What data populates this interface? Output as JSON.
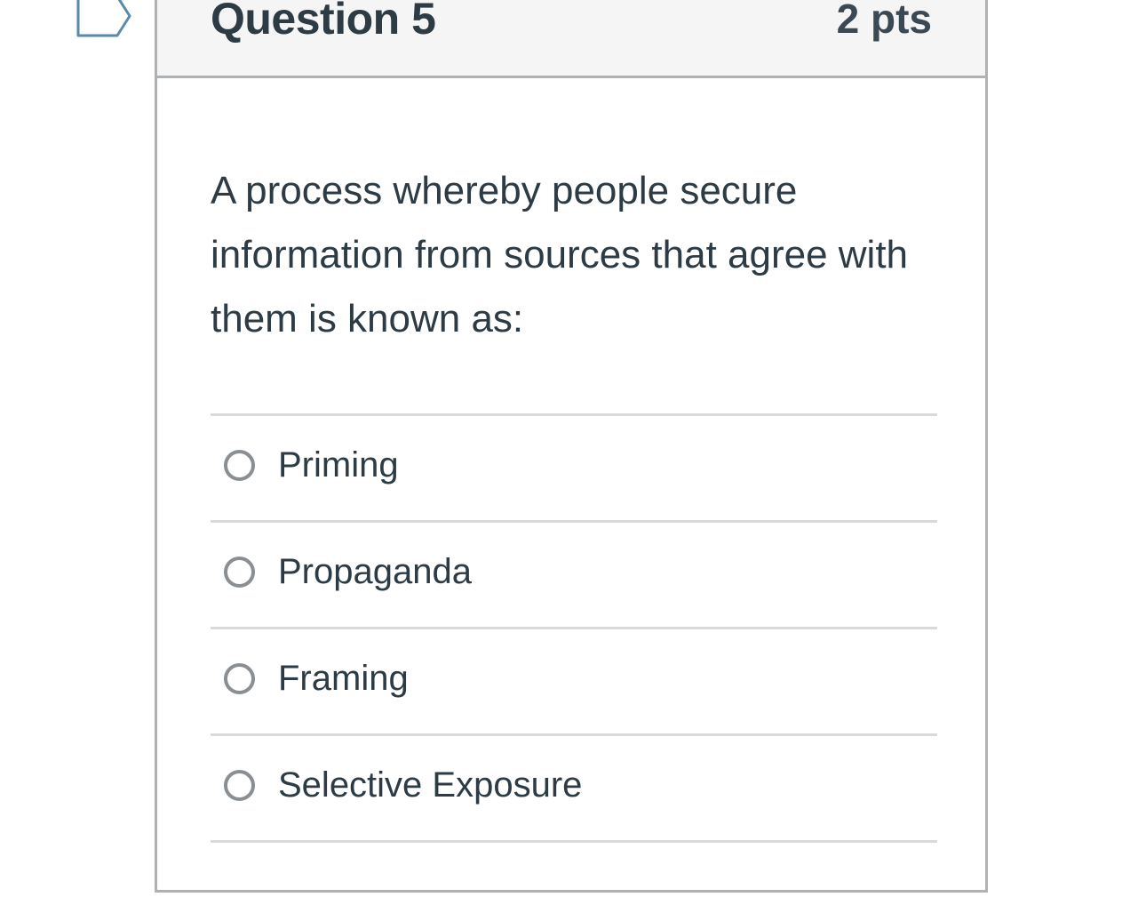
{
  "question": {
    "title": "Question 5",
    "points": "2 pts",
    "text": "A process whereby people secure information from sources that agree with them is known as:",
    "flag_icon": "flag-question-icon"
  },
  "answers": [
    {
      "label": "Priming",
      "selected": false
    },
    {
      "label": "Propaganda",
      "selected": false
    },
    {
      "label": "Framing",
      "selected": false
    },
    {
      "label": "Selective Exposure",
      "selected": false
    }
  ],
  "colors": {
    "text": "#2d3b45",
    "border": "#aeb2b5",
    "header_bg": "#f5f5f5",
    "divider": "#d8dadc",
    "radio": "#8a8f93",
    "flag": "#5b8aa8"
  }
}
